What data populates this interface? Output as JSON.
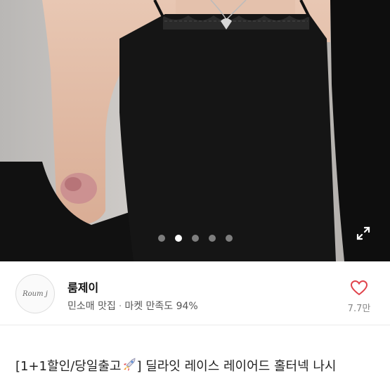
{
  "gallery": {
    "slide_count": 5,
    "active_index": 1,
    "expand_icon": "expand-icon"
  },
  "seller": {
    "avatar_text": "Roum j",
    "name": "룸제이",
    "tag": "민소매 맛집",
    "separator": "·",
    "rating_text": "마켓 만족도 94%"
  },
  "like": {
    "icon": "heart-icon",
    "count": "7.7만"
  },
  "product": {
    "title_prefix": "[1+1할인/당일출고",
    "title_icon": "rocket-icon",
    "title_suffix": "] 딜라잇 레이스 레이어드 홀터넥 나시"
  },
  "colors": {
    "accent": "#e0434b",
    "text": "#222222",
    "muted": "#888888"
  }
}
